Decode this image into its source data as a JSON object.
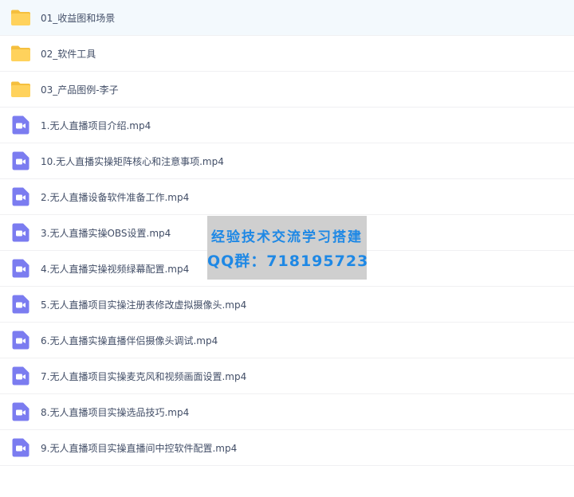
{
  "files": [
    {
      "name": "01_收益图和场景",
      "type": "folder",
      "icon": "folder-icon",
      "selected": true
    },
    {
      "name": "02_软件工具",
      "type": "folder",
      "icon": "folder-icon"
    },
    {
      "name": "03_产品图例-李子",
      "type": "folder",
      "icon": "folder-icon"
    },
    {
      "name": "1.无人直播项目介绍.mp4",
      "type": "video",
      "icon": "video-file-icon"
    },
    {
      "name": "10.无人直播实操矩阵核心和注意事项.mp4",
      "type": "video",
      "icon": "video-file-icon"
    },
    {
      "name": "2.无人直播设备软件准备工作.mp4",
      "type": "video",
      "icon": "video-file-icon"
    },
    {
      "name": "3.无人直播实操OBS设置.mp4",
      "type": "video",
      "icon": "video-file-icon"
    },
    {
      "name": "4.无人直播实操视频绿幕配置.mp4",
      "type": "video",
      "icon": "video-file-icon"
    },
    {
      "name": "5.无人直播项目实操注册表修改虚拟摄像头.mp4",
      "type": "video",
      "icon": "video-file-icon"
    },
    {
      "name": "6.无人直播实操直播伴侣摄像头调试.mp4",
      "type": "video",
      "icon": "video-file-icon"
    },
    {
      "name": "7.无人直播项目实操麦克风和视频画面设置.mp4",
      "type": "video",
      "icon": "video-file-icon"
    },
    {
      "name": "8.无人直播项目实操选品技巧.mp4",
      "type": "video",
      "icon": "video-file-icon"
    },
    {
      "name": "9.无人直播项目实操直播间中控软件配置.mp4",
      "type": "video",
      "icon": "video-file-icon"
    }
  ],
  "watermark": {
    "line1": "经验技术交流学习搭建",
    "line2": "QQ群：718195723"
  },
  "colors": {
    "folder": "#ffd25c",
    "folder_tab": "#f5bf3e",
    "video": "#7b7cf0",
    "selected_row": "#f3f9fd",
    "text": "#424e67",
    "watermark_text": "#1e88e5"
  }
}
